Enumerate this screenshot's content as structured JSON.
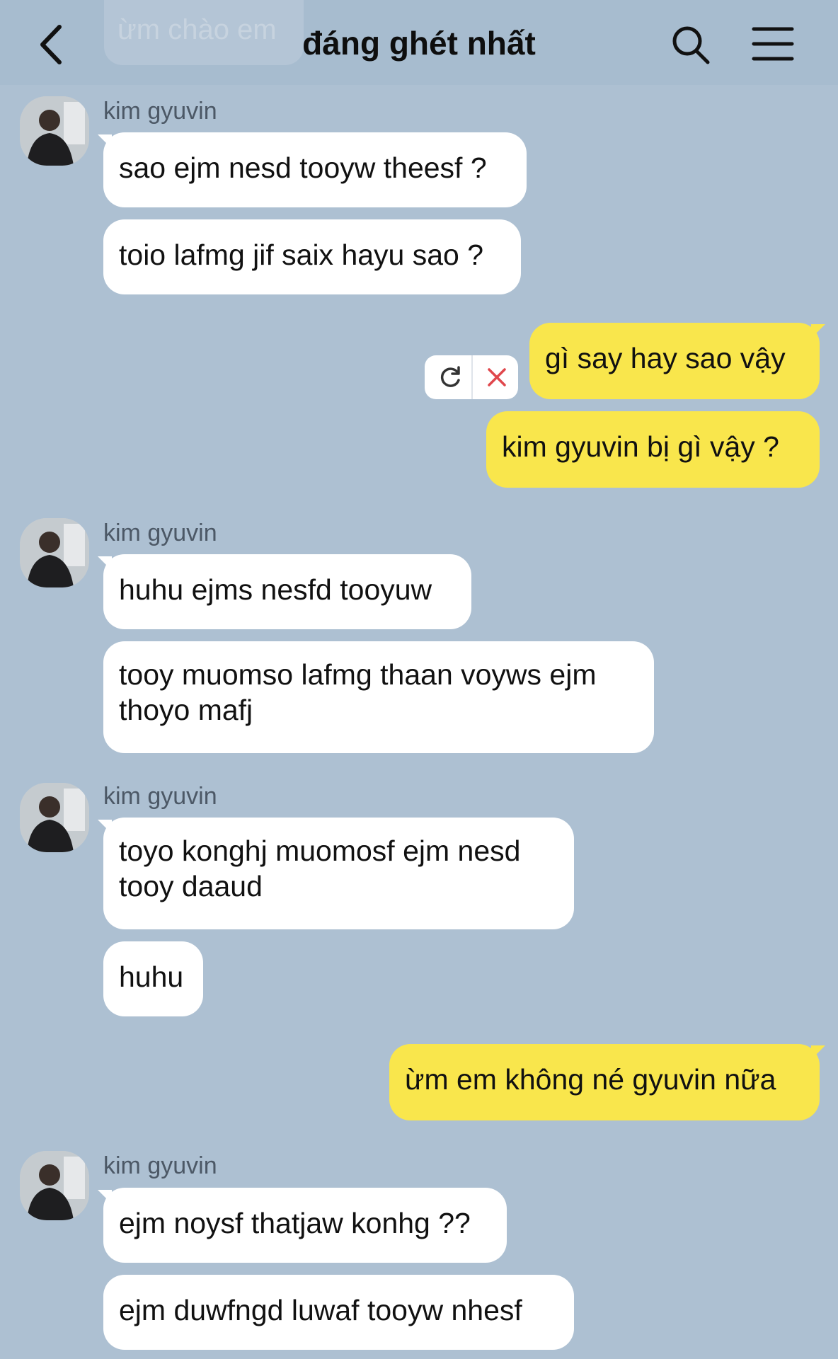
{
  "header": {
    "title": "đáng ghét nhất",
    "back_icon": "chevron-left-icon",
    "search_icon": "search-icon",
    "menu_icon": "hamburger-menu-icon",
    "ghost_message": "ừm chào em"
  },
  "colors": {
    "background": "#adc0d2",
    "incoming_bubble": "#ffffff",
    "outgoing_bubble": "#f9e64c",
    "cancel_red": "#e0474c"
  },
  "sender_name": "kim gyuvin",
  "groups": [
    {
      "sender": "kim gyuvin",
      "messages": [
        "sao ejm nesd tooyw theesf ?",
        "toio lafmg jif saix hayu sao ?"
      ]
    },
    {
      "sender": "me",
      "messages": [
        "gì say hay sao vậy",
        "kim gyuvin bị gì vậy ?"
      ],
      "failed_actions": [
        "retry-icon",
        "cancel-icon"
      ]
    },
    {
      "sender": "kim gyuvin",
      "messages": [
        "huhu ejms nesfd tooyuw",
        "tooy muomso lafmg thaan voyws ejm thoyo mafj"
      ]
    },
    {
      "sender": "kim gyuvin",
      "messages": [
        "toyo konghj muomosf ejm nesd tooy daaud",
        "huhu"
      ]
    },
    {
      "sender": "me",
      "messages": [
        "ừm em không né gyuvin nữa"
      ]
    },
    {
      "sender": "kim gyuvin",
      "messages": [
        "ejm noysf thatjaw konhg ??",
        "ejm duwfngd luwaf tooyw nhesf"
      ]
    }
  ]
}
